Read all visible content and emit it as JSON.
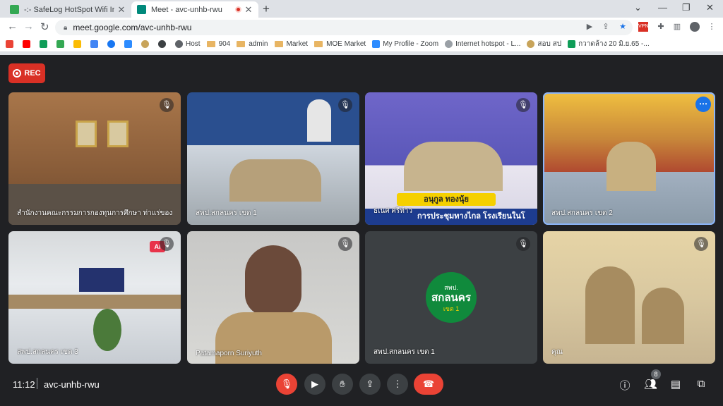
{
  "browser": {
    "tabs": [
      {
        "title": "-:- SafeLog HotSpot Wifi Internet",
        "favicon_color": "#34a853"
      },
      {
        "title": "Meet - avc-unhb-rwu",
        "favicon_color": "#00897b"
      }
    ],
    "new_tab": "+",
    "url": "meet.google.com/avc-unhb-rwu",
    "bookmarks": [
      {
        "label": "",
        "kind": "gmail"
      },
      {
        "label": "",
        "kind": "youtube"
      },
      {
        "label": "",
        "kind": "sheet"
      },
      {
        "label": "",
        "kind": "safelog"
      },
      {
        "label": "",
        "kind": "apps"
      },
      {
        "label": "",
        "kind": "drive"
      },
      {
        "label": "",
        "kind": "facebook"
      },
      {
        "label": "",
        "kind": "zoom"
      },
      {
        "label": "",
        "kind": "seal"
      },
      {
        "label": "",
        "kind": "p"
      },
      {
        "label": "Host",
        "kind": "globe"
      },
      {
        "label": "904",
        "kind": "folder"
      },
      {
        "label": "admin",
        "kind": "folder"
      },
      {
        "label": "Market",
        "kind": "folder"
      },
      {
        "label": "MOE Market",
        "kind": "folder"
      },
      {
        "label": "My Profile - Zoom",
        "kind": "zoom"
      },
      {
        "label": "Internet hotspot - L...",
        "kind": "wifi"
      },
      {
        "label": "สอบ สป",
        "kind": "seal"
      },
      {
        "label": "กวาดล้าง 20 มิ.ย.65 -...",
        "kind": "sheet"
      }
    ]
  },
  "meet": {
    "rec_label": "REC",
    "tiles": [
      {
        "name": "สำนักงานคณะกรรมการกองทุนการศึกษา ท่าแร่ของคุ...",
        "muted": true
      },
      {
        "name": "สพป.สกลนคร เขต 1",
        "muted": true
      },
      {
        "name": "ธเนศ ศรีท้าว",
        "muted": true,
        "caption": "อนุกูล ทองนุ้ย",
        "ticker": "การประชุมทางไกล โรงเรียนในโ"
      },
      {
        "name": "สพป.สกลนคร เขต 2",
        "muted": false,
        "active": true
      },
      {
        "name": "สพป.สกลนคร เขต 3",
        "muted": true
      },
      {
        "name": "Patamaporn Suriyuth",
        "muted": true
      },
      {
        "name": "สพป.สกลนคร เขต 1",
        "muted": true,
        "logo_line1": "สพป.",
        "logo_line2": "สกลนคร",
        "logo_line3": "เขต 1"
      },
      {
        "name": "คุณ",
        "muted": true
      }
    ],
    "clock": "11:12",
    "meeting_code": "avc-unhb-rwu",
    "participants_count": "8"
  }
}
